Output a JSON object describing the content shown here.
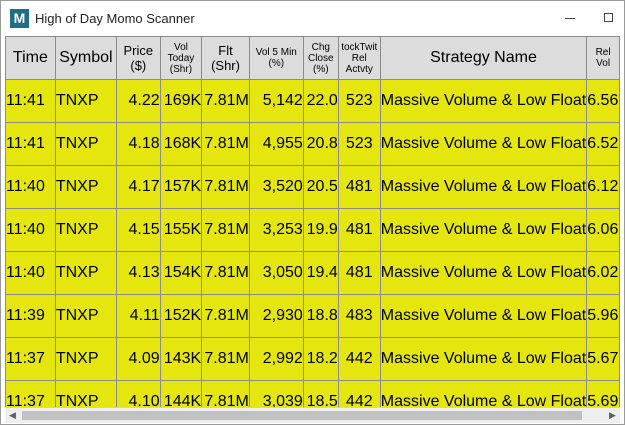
{
  "window": {
    "title": "High of Day Momo Scanner",
    "icon_letter": "M",
    "minimize_icon": "minimize-icon",
    "maximize_icon": "maximize-icon"
  },
  "colors": {
    "row_yellow": "#e6e60f",
    "chg_green": "#c6e11a",
    "stocktwits_green": "#bfe8c3",
    "header_gray": "#dcdcdc"
  },
  "columns": {
    "time": "Time",
    "symbol": "Symbol",
    "price": "Price ($)",
    "vol_today": "Vol Today (Shr)",
    "flt": "Flt (Shr)",
    "vol5": "Vol 5 Min (%)",
    "chg_close": "Chg Close (%)",
    "stocktwits": "tockTwit Rel Actvty",
    "strategy": "Strategy Name",
    "rel_vol": "Rel Vol"
  },
  "rows": [
    {
      "time": "11:41",
      "symbol": "TNXP",
      "price": "4.22",
      "vol_today": "169K",
      "flt": "7.81M",
      "vol5": "5,142",
      "chg": "22.0",
      "stocktwits": "523",
      "strategy": "Massive Volume & Low Float",
      "rel_vol": "6.56"
    },
    {
      "time": "11:41",
      "symbol": "TNXP",
      "price": "4.18",
      "vol_today": "168K",
      "flt": "7.81M",
      "vol5": "4,955",
      "chg": "20.8",
      "stocktwits": "523",
      "strategy": "Massive Volume & Low Float",
      "rel_vol": "6.52"
    },
    {
      "time": "11:40",
      "symbol": "TNXP",
      "price": "4.17",
      "vol_today": "157K",
      "flt": "7.81M",
      "vol5": "3,520",
      "chg": "20.5",
      "stocktwits": "481",
      "strategy": "Massive Volume & Low Float",
      "rel_vol": "6.12"
    },
    {
      "time": "11:40",
      "symbol": "TNXP",
      "price": "4.15",
      "vol_today": "155K",
      "flt": "7.81M",
      "vol5": "3,253",
      "chg": "19.9",
      "stocktwits": "481",
      "strategy": "Massive Volume & Low Float",
      "rel_vol": "6.06"
    },
    {
      "time": "11:40",
      "symbol": "TNXP",
      "price": "4.13",
      "vol_today": "154K",
      "flt": "7.81M",
      "vol5": "3,050",
      "chg": "19.4",
      "stocktwits": "481",
      "strategy": "Massive Volume & Low Float",
      "rel_vol": "6.02"
    },
    {
      "time": "11:39",
      "symbol": "TNXP",
      "price": "4.11",
      "vol_today": "152K",
      "flt": "7.81M",
      "vol5": "2,930",
      "chg": "18.8",
      "stocktwits": "483",
      "strategy": "Massive Volume & Low Float",
      "rel_vol": "5.96"
    },
    {
      "time": "11:37",
      "symbol": "TNXP",
      "price": "4.09",
      "vol_today": "143K",
      "flt": "7.81M",
      "vol5": "2,992",
      "chg": "18.2",
      "stocktwits": "442",
      "strategy": "Massive Volume & Low Float",
      "rel_vol": "5.67"
    },
    {
      "time": "11:37",
      "symbol": "TNXP",
      "price": "4.10",
      "vol_today": "144K",
      "flt": "7.81M",
      "vol5": "3,039",
      "chg": "18.5",
      "stocktwits": "442",
      "strategy": "Massive Volume & Low Float",
      "rel_vol": "5.69"
    }
  ],
  "scrollbar": {
    "left_icon": "scroll-left-icon",
    "right_icon": "scroll-right-icon"
  }
}
